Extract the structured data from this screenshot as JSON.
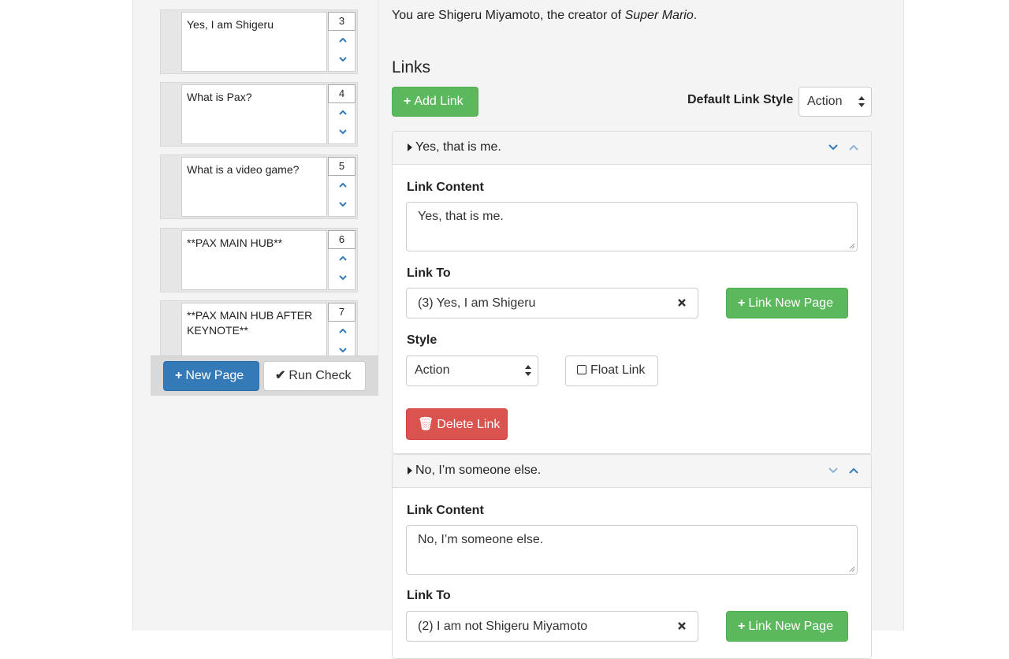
{
  "sidebar": {
    "pages": [
      {
        "title": "Yes, I am Shigeru",
        "number": "3"
      },
      {
        "title": "What is Pax?",
        "number": "4"
      },
      {
        "title": "What is a video game?",
        "number": "5"
      },
      {
        "title": "**PAX MAIN HUB**",
        "number": "6"
      },
      {
        "title": "**PAX MAIN HUB AFTER KEYNOTE**",
        "number": "7"
      }
    ],
    "new_page_label": "New Page",
    "run_check_label": "Run Check"
  },
  "main": {
    "intro_prefix": "You are Shigeru Miyamoto, the creator of ",
    "intro_emphasis": "Super Mario",
    "intro_suffix": ".",
    "links_heading": "Links",
    "add_link_label": "Add Link",
    "default_link_style_label": "Default Link Style",
    "default_link_style_value": "Action",
    "links": [
      {
        "header": "Yes, that is me.",
        "content_label": "Link Content",
        "content": "Yes, that is me.",
        "link_to_label": "Link To",
        "link_to": "(3) Yes, I am Shigeru",
        "link_new_page_label": "Link New Page",
        "style_label": "Style",
        "style_value": "Action",
        "float_link_label": "Float Link",
        "delete_label": "Delete Link"
      },
      {
        "header": "No, I’m someone else.",
        "content_label": "Link Content",
        "content": "No, I’m someone else.",
        "link_to_label": "Link To",
        "link_to": "(2) I am not Shigeru Miyamoto",
        "link_new_page_label": "Link New Page"
      }
    ]
  },
  "colors": {
    "primary": "#337ab7",
    "success": "#5cb85c",
    "danger": "#d9534f",
    "chevron": "#337ab7"
  }
}
